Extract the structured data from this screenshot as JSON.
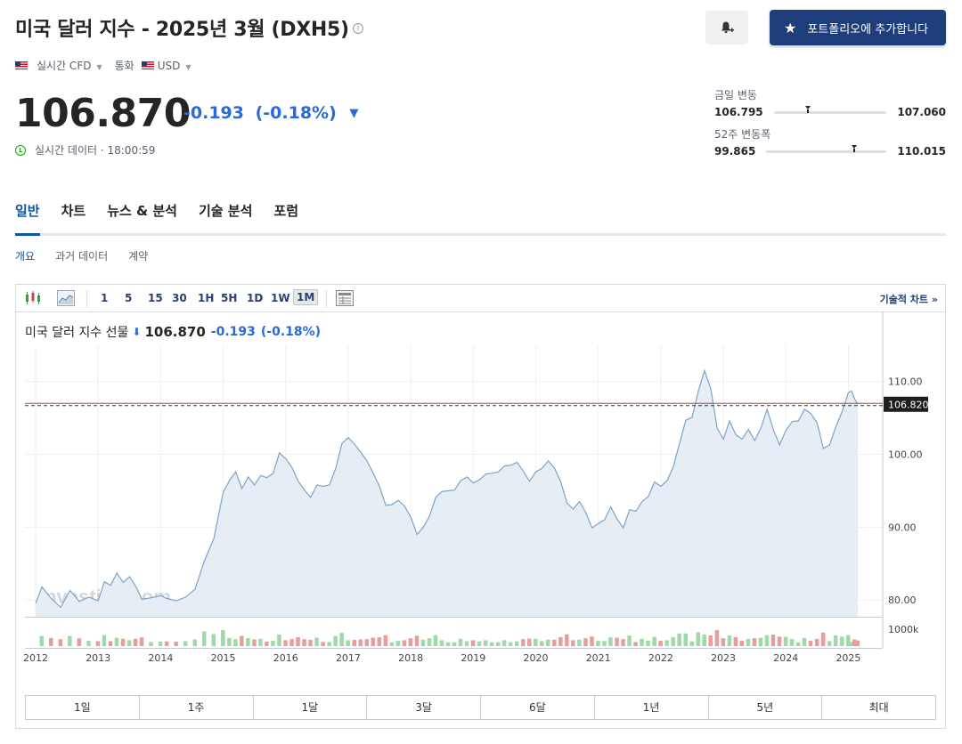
{
  "header": {
    "title": "미국 달러 지수 - 2025년 3월 (DXH5)",
    "info_icon": "i",
    "portfolio_label": "포트폴리오에 추가합니다",
    "source_label": "실시간 CFD",
    "currency_prefix": "통화",
    "currency": "USD"
  },
  "quote": {
    "price": "106.870",
    "change": "-0.193",
    "change_pct": "(-0.18%)",
    "time_label": "실시간 데이터 · 18:00:59"
  },
  "ranges": {
    "day": {
      "title": "금일 변동",
      "low": "106.795",
      "high": "107.060",
      "position": 0.28
    },
    "week52": {
      "title": "52주 변동폭",
      "low": "99.865",
      "high": "110.015",
      "position": 0.71
    }
  },
  "tabs": [
    {
      "label": "일반"
    },
    {
      "label": "차트"
    },
    {
      "label": "뉴스 & 분석"
    },
    {
      "label": "기술 분석"
    },
    {
      "label": "포럼"
    }
  ],
  "subtabs": [
    {
      "label": "개요"
    },
    {
      "label": "과거 데이터"
    },
    {
      "label": "계약"
    }
  ],
  "chart_toolbar": {
    "intervals": [
      "1",
      "5",
      "15",
      "30",
      "1H",
      "5H",
      "1D",
      "1W",
      "1M"
    ],
    "active_interval": "1M",
    "tech_link": "기술적 차트"
  },
  "chart_head": {
    "name": "미국 달러 지수 선물",
    "price": "106.870",
    "change": "-0.193",
    "change_pct": "(-0.18%)"
  },
  "periods": [
    "1일",
    "1주",
    "1달",
    "3달",
    "6달",
    "1년",
    "5년",
    "최대"
  ],
  "colors": {
    "accent": "#1e3d7b",
    "negative": "#2a6ad8",
    "line": "#7ea3c8",
    "area": "#e6edf5",
    "vol_up": "#9fd9a8",
    "vol_down": "#e89c9c",
    "price_line": "#c0392b"
  },
  "chart_data": {
    "type": "area",
    "y_ticks": [
      80,
      90,
      100,
      110
    ],
    "ylim": [
      77.7,
      114
    ],
    "x_ticks": [
      "2012",
      "2013",
      "2014",
      "2015",
      "2016",
      "2017",
      "2018",
      "2019",
      "2020",
      "2021",
      "2022",
      "2023",
      "2024",
      "2025"
    ],
    "x_range": [
      2012.0,
      2025.25
    ],
    "current_price_label": "106.820",
    "current_price": 106.82,
    "volume_label": "1000k",
    "watermark": "Investing.com",
    "series": [
      {
        "values": [
          [
            2012.0,
            79.5
          ],
          [
            2012.1,
            81.8
          ],
          [
            2012.25,
            80.2
          ],
          [
            2012.4,
            79.0
          ],
          [
            2012.55,
            81.3
          ],
          [
            2012.7,
            79.8
          ],
          [
            2012.85,
            80.4
          ],
          [
            2013.0,
            79.9
          ],
          [
            2013.1,
            82.5
          ],
          [
            2013.2,
            82.0
          ],
          [
            2013.3,
            83.7
          ],
          [
            2013.4,
            82.4
          ],
          [
            2013.5,
            83.2
          ],
          [
            2013.6,
            81.9
          ],
          [
            2013.7,
            80.1
          ],
          [
            2013.85,
            80.3
          ],
          [
            2014.0,
            80.6
          ],
          [
            2014.1,
            80.2
          ],
          [
            2014.25,
            79.9
          ],
          [
            2014.4,
            80.4
          ],
          [
            2014.55,
            81.5
          ],
          [
            2014.7,
            85.4
          ],
          [
            2014.85,
            88.4
          ],
          [
            2015.0,
            94.8
          ],
          [
            2015.1,
            96.4
          ],
          [
            2015.2,
            97.6
          ],
          [
            2015.3,
            95.3
          ],
          [
            2015.4,
            96.9
          ],
          [
            2015.5,
            95.8
          ],
          [
            2015.6,
            97.1
          ],
          [
            2015.7,
            96.8
          ],
          [
            2015.8,
            97.4
          ],
          [
            2015.9,
            100.2
          ],
          [
            2016.0,
            99.4
          ],
          [
            2016.1,
            98.2
          ],
          [
            2016.2,
            96.3
          ],
          [
            2016.3,
            95.1
          ],
          [
            2016.4,
            94.1
          ],
          [
            2016.5,
            95.8
          ],
          [
            2016.6,
            95.6
          ],
          [
            2016.7,
            95.8
          ],
          [
            2016.8,
            98.1
          ],
          [
            2016.9,
            101.5
          ],
          [
            2017.0,
            102.3
          ],
          [
            2017.1,
            101.4
          ],
          [
            2017.2,
            100.3
          ],
          [
            2017.3,
            99.1
          ],
          [
            2017.4,
            97.4
          ],
          [
            2017.5,
            95.6
          ],
          [
            2017.6,
            93.0
          ],
          [
            2017.7,
            93.1
          ],
          [
            2017.8,
            93.7
          ],
          [
            2017.9,
            92.9
          ],
          [
            2018.0,
            91.4
          ],
          [
            2018.1,
            89.0
          ],
          [
            2018.2,
            90.0
          ],
          [
            2018.3,
            91.5
          ],
          [
            2018.4,
            94.1
          ],
          [
            2018.5,
            94.9
          ],
          [
            2018.6,
            95.0
          ],
          [
            2018.7,
            95.1
          ],
          [
            2018.8,
            96.4
          ],
          [
            2018.9,
            96.9
          ],
          [
            2019.0,
            96.1
          ],
          [
            2019.1,
            96.5
          ],
          [
            2019.2,
            97.3
          ],
          [
            2019.3,
            97.4
          ],
          [
            2019.4,
            97.6
          ],
          [
            2019.5,
            98.4
          ],
          [
            2019.6,
            98.5
          ],
          [
            2019.7,
            98.9
          ],
          [
            2019.8,
            97.7
          ],
          [
            2019.9,
            96.3
          ],
          [
            2020.0,
            97.6
          ],
          [
            2020.1,
            98.1
          ],
          [
            2020.2,
            99.1
          ],
          [
            2020.3,
            98.1
          ],
          [
            2020.4,
            96.2
          ],
          [
            2020.5,
            93.3
          ],
          [
            2020.6,
            92.5
          ],
          [
            2020.7,
            93.5
          ],
          [
            2020.8,
            92.0
          ],
          [
            2020.9,
            89.9
          ],
          [
            2021.0,
            90.5
          ],
          [
            2021.1,
            91.0
          ],
          [
            2021.2,
            92.8
          ],
          [
            2021.3,
            91.1
          ],
          [
            2021.4,
            89.9
          ],
          [
            2021.5,
            92.4
          ],
          [
            2021.6,
            92.2
          ],
          [
            2021.7,
            93.5
          ],
          [
            2021.8,
            94.2
          ],
          [
            2021.9,
            96.2
          ],
          [
            2022.0,
            95.6
          ],
          [
            2022.1,
            96.4
          ],
          [
            2022.2,
            98.3
          ],
          [
            2022.3,
            101.5
          ],
          [
            2022.4,
            104.7
          ],
          [
            2022.5,
            105.1
          ],
          [
            2022.6,
            108.7
          ],
          [
            2022.7,
            111.5
          ],
          [
            2022.8,
            109.0
          ],
          [
            2022.9,
            103.6
          ],
          [
            2023.0,
            102.1
          ],
          [
            2023.1,
            104.6
          ],
          [
            2023.2,
            102.7
          ],
          [
            2023.3,
            102.1
          ],
          [
            2023.4,
            103.4
          ],
          [
            2023.5,
            101.9
          ],
          [
            2023.6,
            103.6
          ],
          [
            2023.7,
            106.2
          ],
          [
            2023.8,
            103.4
          ],
          [
            2023.9,
            101.3
          ],
          [
            2024.0,
            103.3
          ],
          [
            2024.1,
            104.5
          ],
          [
            2024.2,
            104.6
          ],
          [
            2024.3,
            106.2
          ],
          [
            2024.4,
            105.6
          ],
          [
            2024.5,
            104.3
          ],
          [
            2024.6,
            100.8
          ],
          [
            2024.7,
            101.3
          ],
          [
            2024.8,
            103.8
          ],
          [
            2024.9,
            105.9
          ],
          [
            2025.0,
            108.5
          ],
          [
            2025.05,
            108.7
          ],
          [
            2025.1,
            107.6
          ],
          [
            2025.15,
            106.87
          ]
        ]
      }
    ]
  }
}
